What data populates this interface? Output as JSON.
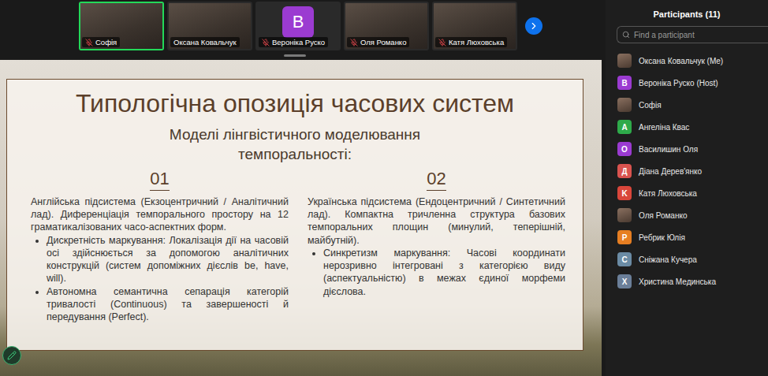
{
  "video_strip": {
    "tiles": [
      {
        "name": "Софія",
        "kind": "photo",
        "muted": true,
        "selected": true
      },
      {
        "name": "Оксана Ковальчук",
        "kind": "photo",
        "muted": false,
        "selected": false
      },
      {
        "name": "Вероніка Руско",
        "kind": "letter",
        "initial": "B",
        "color": "#9b3bd1",
        "muted": true,
        "selected": false
      },
      {
        "name": "Оля Романко",
        "kind": "photo",
        "muted": true,
        "selected": false
      },
      {
        "name": "Катя Люховська",
        "kind": "photo",
        "muted": true,
        "selected": false
      }
    ]
  },
  "slide": {
    "title": "Типологічна опозиція часових систем",
    "subtitle": "Моделі лінгвістичного моделювання темпоральності:",
    "columns": [
      {
        "number": "01",
        "intro": "Англійська підсистема (Екзоцентричний / Аналітичний лад). Диференціація темпорального простору на 12 граматикалізованих часо-аспектних форм.",
        "bullets": [
          "Дискретність маркування: Локалізація дії на часовій осі здійснюється за допомогою аналітичних конструкцій (систем допоміжних дієслів be, have, will).",
          "Автономна семантична сепарація категорій тривалості (Continuous) та завершеності й передування (Perfect)."
        ]
      },
      {
        "number": "02",
        "intro": "Українська підсистема (Ендоцентричний / Синтетичний лад). Компактна тричленна структура базових темпоральних площин (минулий, теперішній, майбутній).",
        "bullets": [
          "Синкретизм маркування: Часові координати нерозривно інтегровані з категорією виду (аспектуальністю) в межах єдиної морфеми дієслова."
        ]
      }
    ]
  },
  "participants": {
    "title": "Participants (11)",
    "search": {
      "placeholder": "Find a participant"
    },
    "items": [
      {
        "name": "Оксана Ковальчук (Me)",
        "kind": "photo"
      },
      {
        "name": "Вероніка Руско (Host)",
        "kind": "letter",
        "initial": "B",
        "color": "#9b3bd1"
      },
      {
        "name": "Софія",
        "kind": "photo"
      },
      {
        "name": "Ангеліна Квас",
        "kind": "letter",
        "initial": "A",
        "color": "#2eaa4a"
      },
      {
        "name": "Василишин Оля",
        "kind": "letter",
        "initial": "O",
        "color": "#9b3bd1"
      },
      {
        "name": "Діана Дерев'янко",
        "kind": "letter",
        "initial": "Д",
        "color": "#d9534f"
      },
      {
        "name": "Катя Люховська",
        "kind": "letter",
        "initial": "K",
        "color": "#d9463b"
      },
      {
        "name": "Оля Романко",
        "kind": "photo"
      },
      {
        "name": "Ребрик Юлія",
        "kind": "letter",
        "initial": "P",
        "color": "#e67e22"
      },
      {
        "name": "Сніжана Кучера",
        "kind": "letter",
        "initial": "C",
        "color": "#6b8ba4"
      },
      {
        "name": "Христина Мединська",
        "kind": "letter",
        "initial": "X",
        "color": "#6b7f99"
      }
    ]
  }
}
